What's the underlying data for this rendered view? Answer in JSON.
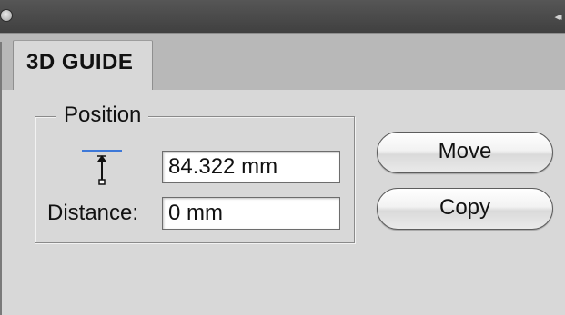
{
  "panel": {
    "tab_label": "3D GUIDE",
    "collapse_glyph": "◂◂"
  },
  "position_group": {
    "legend": "Position",
    "position_value": "84.322 mm",
    "distance_label": "Distance:",
    "distance_value": "0 mm",
    "icon": "guide-offset-icon"
  },
  "actions": {
    "move_label": "Move",
    "copy_label": "Copy"
  },
  "colors": {
    "titlebar": "#4a4a4a",
    "panel_bg": "#d8d8d8",
    "tabstrip_bg": "#b8b8b8",
    "guide_line": "#3d78d8"
  }
}
